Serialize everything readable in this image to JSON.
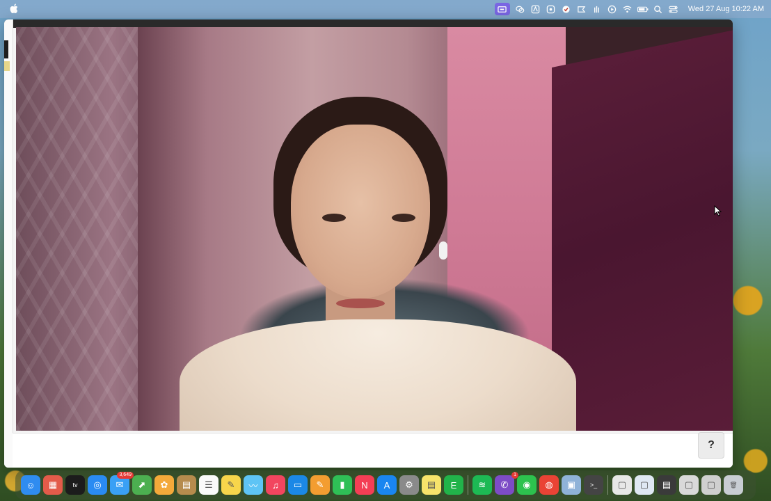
{
  "menubar": {
    "clock": "Wed 27 Aug  10:22 AM",
    "status_icons": [
      "screen-record-icon",
      "wechat-icon",
      "text-input-icon",
      "hotspot-icon",
      "vpn-icon",
      "recorder-icon",
      "clipboard-icon",
      "play-icon",
      "wifi-icon",
      "battery-icon",
      "search-icon",
      "control-center-icon"
    ]
  },
  "window": {
    "help_label": "?"
  },
  "dock": {
    "apps": [
      {
        "name": "finder",
        "color": "#2f8cf0",
        "glyph": "☺"
      },
      {
        "name": "launchpad",
        "color": "#e35b4a",
        "glyph": "▦"
      },
      {
        "name": "apple-tv",
        "color": "#1c1c1c",
        "glyph": "tv"
      },
      {
        "name": "safari",
        "color": "#2a8bf2",
        "glyph": "◎"
      },
      {
        "name": "mail",
        "color": "#3aa0f5",
        "glyph": "✉",
        "badge": "3,649"
      },
      {
        "name": "maps",
        "color": "#4caf50",
        "glyph": "⬈"
      },
      {
        "name": "photos",
        "color": "#f4a93a",
        "glyph": "✿"
      },
      {
        "name": "notes-brown",
        "color": "#b68b4d",
        "glyph": "▤"
      },
      {
        "name": "reminders",
        "color": "#fafafa",
        "glyph": "☰"
      },
      {
        "name": "notes",
        "color": "#f7d54b",
        "glyph": "✎"
      },
      {
        "name": "freeform",
        "color": "#5ec4f5",
        "glyph": "〰"
      },
      {
        "name": "music",
        "color": "#f2455f",
        "glyph": "♫"
      },
      {
        "name": "keynote",
        "color": "#1b88e6",
        "glyph": "▭"
      },
      {
        "name": "pages",
        "color": "#f39d31",
        "glyph": "✎"
      },
      {
        "name": "numbers",
        "color": "#2fbf56",
        "glyph": "▮"
      },
      {
        "name": "news",
        "color": "#f43e55",
        "glyph": "N"
      },
      {
        "name": "app-store",
        "color": "#1a86f0",
        "glyph": "A"
      },
      {
        "name": "system-settings",
        "color": "#8a8a8a",
        "glyph": "⚙"
      },
      {
        "name": "stickies",
        "color": "#f7e36b",
        "glyph": "▤"
      },
      {
        "name": "evernote",
        "color": "#21b34a",
        "glyph": "E"
      },
      {
        "name": "spotify",
        "color": "#1db954",
        "glyph": "≋"
      },
      {
        "name": "viber",
        "color": "#7d4cc6",
        "glyph": "✆",
        "badge": "1"
      },
      {
        "name": "wechat",
        "color": "#2dc24e",
        "glyph": "◉"
      },
      {
        "name": "chrome",
        "color": "#ea4335",
        "glyph": "◍"
      },
      {
        "name": "preview",
        "color": "#8fb2d8",
        "glyph": "▣"
      },
      {
        "name": "terminal",
        "color": "#444444",
        "glyph": ">_"
      },
      {
        "name": "recent-doc-1",
        "color": "#e7e7e7",
        "glyph": "▢"
      },
      {
        "name": "recent-doc-2",
        "color": "#dfe8f3",
        "glyph": "▢"
      },
      {
        "name": "recent-doc-3",
        "color": "#3a3a3a",
        "glyph": "▤"
      },
      {
        "name": "recent-doc-4",
        "color": "#d9d9d9",
        "glyph": "▢"
      },
      {
        "name": "recent-doc-5",
        "color": "#cfcfcf",
        "glyph": "▢"
      },
      {
        "name": "trash",
        "color": "#c8cdd3",
        "glyph": "🗑"
      }
    ]
  }
}
